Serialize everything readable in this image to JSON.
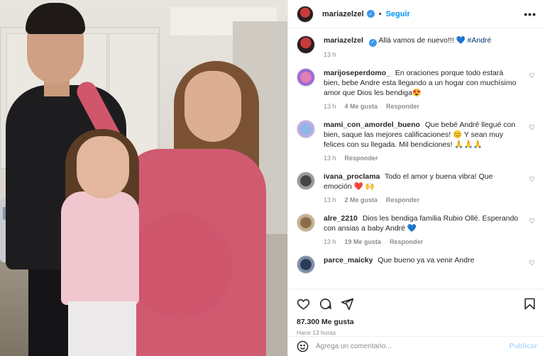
{
  "post": {
    "username": "mariazelzel",
    "follow_label": "Seguir",
    "separator": "•",
    "more_label": "•••"
  },
  "caption": {
    "username": "mariazelzel",
    "text": "Allá vamos de nuevo!!! 💙",
    "hashtag": "#André",
    "time": "13 h"
  },
  "comments": [
    {
      "username": "marijoseperdomo_",
      "text": "En oraciones porque todo estará bien, bebe Andre esta llegando a un hogar con muchísimo amor que Dios les bendiga😍",
      "time": "13 h",
      "likes": "4 Me gusta",
      "reply": "Responder"
    },
    {
      "username": "mami_con_amordel_bueno",
      "text": "Que bebé André llegué con bien, saque las mejores calificaciones! 😊 Y sean muy felices con su llegada. Mil bendiciones! 🙏🙏🙏",
      "time": "13 h",
      "likes": "",
      "reply": "Responder"
    },
    {
      "username": "ivana_proclama",
      "text": "Todo el amor y buena vibra! Que emoción ❤️ 🙌",
      "time": "13 h",
      "likes": "2 Me gusta",
      "reply": "Responder"
    },
    {
      "username": "alre_2210",
      "text": "Dios les bendiga familia Rubio Ollé. Esperando con ansias a baby André 💙",
      "time": "13 h",
      "likes": "19 Me gusta",
      "reply": "Responder"
    },
    {
      "username": "parce_maicky",
      "text": "Que bueno ya va venir Andre",
      "time": "",
      "likes": "",
      "reply": ""
    }
  ],
  "stats": {
    "likes": "87.300 Me gusta",
    "ago": "Hace 13 horas"
  },
  "add_comment": {
    "placeholder": "Agrega un comentario...",
    "publish_label": "Publicar"
  },
  "icons": {
    "heart": "heart-icon",
    "comment": "comment-icon",
    "share": "share-icon",
    "save": "bookmark-icon",
    "emoji": "emoji-icon",
    "more": "more-icon"
  },
  "colors": {
    "accent": "#0095f6",
    "verified": "#3897f0",
    "publish_disabled": "#b3dbff",
    "muted": "#8e8e8e"
  }
}
